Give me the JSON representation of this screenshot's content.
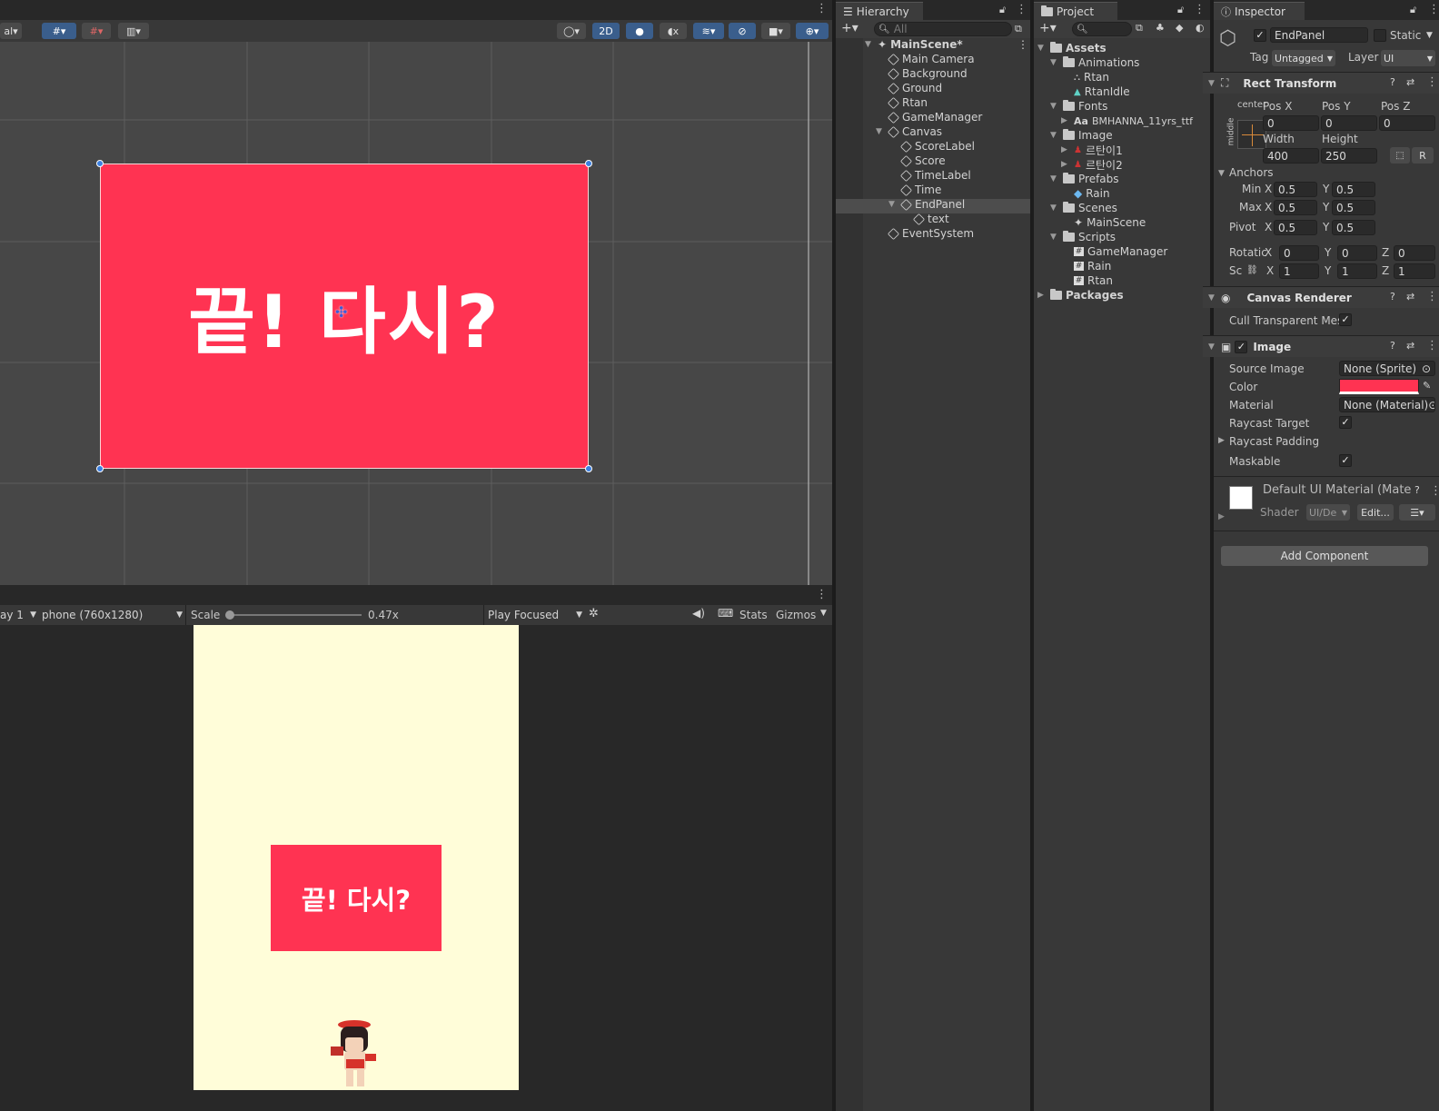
{
  "scene_toolbar": {
    "left_mode": "al",
    "two_d": "2D"
  },
  "game_toolbar": {
    "display": "ay 1",
    "resolution": "phone (760x1280)",
    "scale_label": "Scale",
    "scale_value": "0.47x",
    "play_mode": "Play Focused",
    "stats": "Stats",
    "gizmos": "Gizmos"
  },
  "scene_view": {
    "panel_text": "끝! 다시?",
    "panel_color": "#ff3352",
    "grid_color": "#5a5a5a",
    "bg": "#474747"
  },
  "game_view": {
    "panel_text": "끝! 다시?",
    "panel_color": "#ff3352",
    "bg": "#fffdd9"
  },
  "hierarchy": {
    "tab": "Hierarchy",
    "search_placeholder": "All",
    "scene": "MainScene*",
    "items": [
      "Main Camera",
      "Background",
      "Ground",
      "Rtan",
      "GameManager",
      "Canvas",
      "ScoreLabel",
      "Score",
      "TimeLabel",
      "Time",
      "EndPanel",
      "text",
      "EventSystem"
    ]
  },
  "project": {
    "tab": "Project",
    "items": [
      "Assets",
      "Animations",
      "Rtan",
      "RtanIdle",
      "Fonts",
      "BMHANNA_11yrs_ttf",
      "Image",
      "르탄이1",
      "르탄이2",
      "Prefabs",
      "Rain",
      "Scenes",
      "MainScene",
      "Scripts",
      "GameManager",
      "Rain",
      "Rtan",
      "Packages"
    ],
    "font_prefix": "Aa"
  },
  "inspector": {
    "tab": "Inspector",
    "name": "EndPanel",
    "static": "Static",
    "tag_label": "Tag",
    "tag": "Untagged",
    "layer_label": "Layer",
    "layer": "UI",
    "rect": {
      "title": "Rect Transform",
      "anchor_h": "center",
      "anchor_v": "middle",
      "posx_l": "Pos X",
      "posy_l": "Pos Y",
      "posz_l": "Pos Z",
      "posx": "0",
      "posy": "0",
      "posz": "0",
      "w_l": "Width",
      "h_l": "Height",
      "w": "400",
      "h": "250",
      "r": "R",
      "anchors": "Anchors",
      "min": "Min",
      "max": "Max",
      "x": "X",
      "y": "Y",
      "z": "Z",
      "minx": "0.5",
      "miny": "0.5",
      "maxx": "0.5",
      "maxy": "0.5",
      "pivot": "Pivot",
      "px": "0.5",
      "py": "0.5",
      "rot": "Rotatic",
      "rx": "0",
      "ry": "0",
      "rz": "0",
      "sc": "Sc",
      "sx": "1",
      "sy": "1",
      "sz": "1"
    },
    "canvas_renderer": {
      "title": "Canvas Renderer",
      "cull": "Cull Transparent Mes"
    },
    "image": {
      "title": "Image",
      "source_l": "Source Image",
      "source": "None (Sprite)",
      "color_l": "Color",
      "color": "#ff3352",
      "material_l": "Material",
      "material": "None (Material)",
      "raycast": "Raycast Target",
      "padding": "Raycast Padding",
      "maskable": "Maskable"
    },
    "material": {
      "title": "Default UI Material (Mate",
      "shader_l": "Shader",
      "shader": "UI/De",
      "edit": "Edit..."
    },
    "add_component": "Add Component"
  }
}
